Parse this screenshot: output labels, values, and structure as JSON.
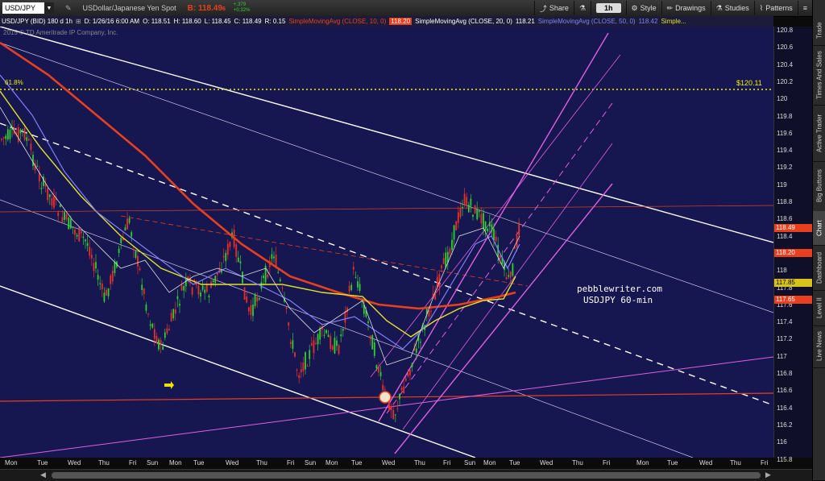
{
  "toolbar": {
    "symbol": "USD/JPY",
    "description": "USDollar/Japanese Yen Spot",
    "bid_label": "B: 118.49",
    "bid_suffix": "6",
    "change_up": "+.379",
    "change_pct": "+0.32%",
    "share_label": "Share",
    "timeframe": "1h",
    "style_label": "Style",
    "drawings_label": "Drawings",
    "studies_label": "Studies",
    "patterns_label": "Patterns"
  },
  "infobar": {
    "title": "USD/JPY (BID) 180 d 1h",
    "date": "D: 1/26/16 6:00 AM",
    "open": "O: 118.51",
    "high": "H: 118.60",
    "low": "L: 118.45",
    "close": "C: 118.49",
    "range": "R: 0.15",
    "sma10": "SimpleMovingAvg (CLOSE, 10, 0)",
    "sma10_val": "118.20",
    "sma20": "SimpleMovingAvg (CLOSE, 20, 0)",
    "sma20_val": "118.21",
    "sma50": "SimpleMovingAvg (CLOSE, 50, 0)",
    "sma50_val": "118.42",
    "more": "Simple..."
  },
  "copyright": "2015 © TD Ameritrade IP Company, Inc.",
  "annotations": {
    "fib_label": "61.8%",
    "target_label": "$120.11",
    "watermark_line1": "pebblewriter.com",
    "watermark_line2": "USDJPY 60-min"
  },
  "price_axis": {
    "ticks": [
      "120.8",
      "120.6",
      "120.4",
      "120.2",
      "120",
      "119.8",
      "119.6",
      "119.4",
      "119.2",
      "119",
      "118.8",
      "118.6",
      "118.4",
      "118.2",
      "118",
      "117.8",
      "117.6",
      "117.4",
      "117.2",
      "117",
      "116.8",
      "116.6",
      "116.4",
      "116.2",
      "116",
      "115.8"
    ],
    "labels": [
      {
        "text": "118.49",
        "price": 118.49,
        "color": "#e8401e"
      },
      {
        "text": "118.20",
        "price": 118.2,
        "color": "#e8401e"
      },
      {
        "text": "117.85",
        "price": 117.85,
        "color": "#d6c21a"
      },
      {
        "text": "117.65",
        "price": 117.65,
        "color": "#e8401e"
      }
    ]
  },
  "time_axis": {
    "labels": [
      "Mon",
      "Tue",
      "Wed",
      "Thu",
      "Fri",
      "Sun",
      "Mon",
      "Tue",
      "Wed",
      "Thu",
      "Fri",
      "Sun",
      "Mon",
      "Tue",
      "Wed",
      "Thu",
      "Fri",
      "Sun",
      "Mon",
      "Tue",
      "Wed",
      "Thu",
      "Fri",
      "Mon",
      "Tue",
      "Wed",
      "Thu",
      "Fri"
    ]
  },
  "side_tabs": [
    "Trade",
    "Times And Sales",
    "Active Trader",
    "Big Buttons",
    "Chart",
    "Dashboard",
    "Level II",
    "Live News"
  ],
  "colors": {
    "background": "#161650",
    "bid": "#e8401e",
    "sma_red": "#e8401e",
    "sma_yellow": "#e3e32a",
    "sma_blue": "#8080ff",
    "channel_magenta": "#e060e0",
    "fib_yellow": "#f0f000"
  }
}
